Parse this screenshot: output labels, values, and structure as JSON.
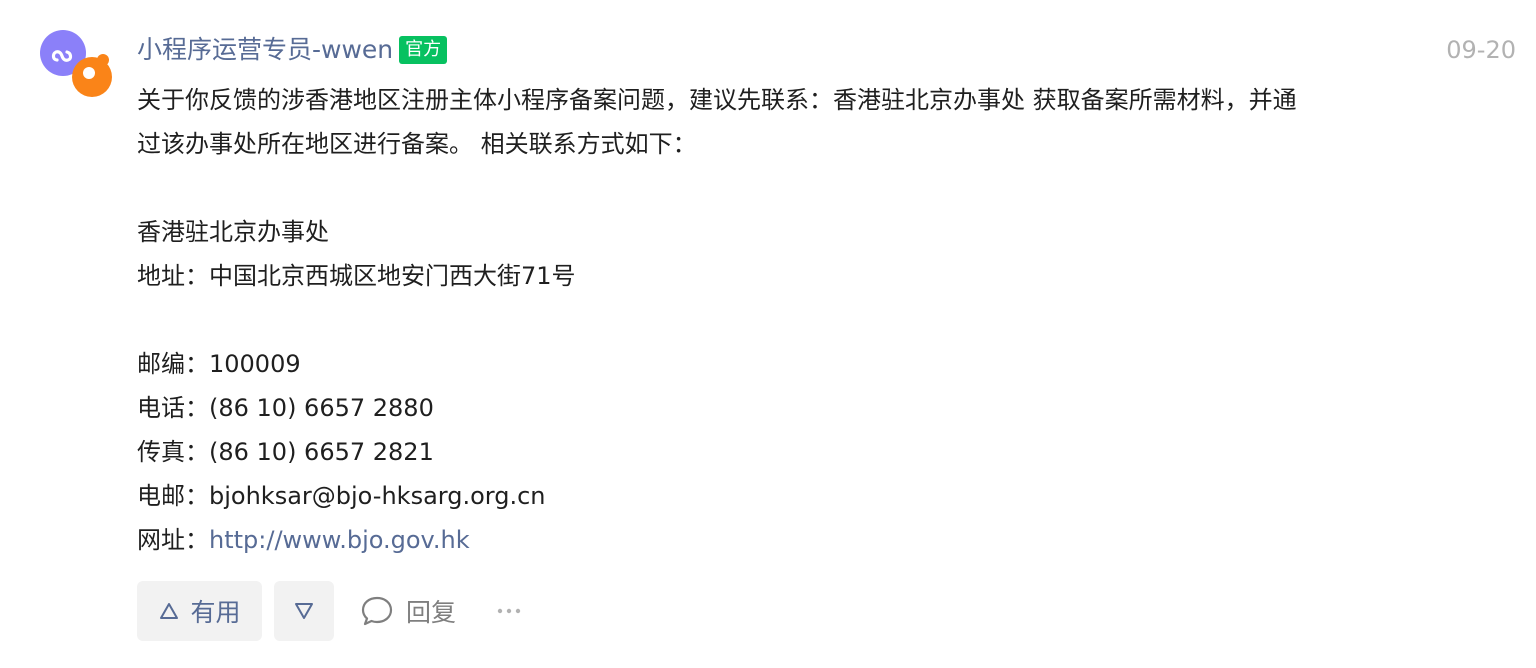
{
  "post": {
    "author": "小程序运营专员-wwen",
    "badge": "官方",
    "date": "09-20",
    "body_lines": [
      "关于你反馈的涉香港地区注册主体小程序备案问题，建议先联系：香港驻北京办事处  获取备案所需材料，并通",
      "过该办事处所在地区进行备案。 相关联系方式如下：",
      "",
      "香港驻北京办事处",
      "地址：中国北京西城区地安门西大街71号",
      "",
      "邮编：100009",
      "电话：(86 10) 6657 2880",
      "传真：(86 10) 6657 2821",
      "电邮：bjohksar@bjo-hksarg.org.cn"
    ],
    "website_label": "网址：",
    "website_url": "http://www.bjo.gov.hk"
  },
  "actions": {
    "useful_label": "有用",
    "reply_label": "回复",
    "more_label": "···"
  },
  "icons": {
    "avatar": "mini-program-logo",
    "useful": "triangle-up-icon",
    "down": "triangle-down-icon",
    "reply": "comment-bubble-icon",
    "more": "more-dots-icon"
  },
  "colors": {
    "link": "#576b95",
    "badge_bg": "#07c160",
    "muted": "#b2b2b2",
    "avatar_purple": "#8b80f9",
    "avatar_orange": "#fa8418"
  }
}
